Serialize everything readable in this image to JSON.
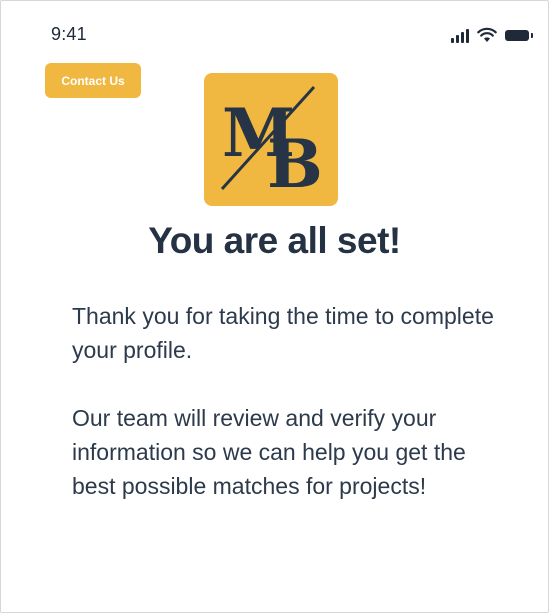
{
  "status_bar": {
    "time": "9:41",
    "icons": [
      "signal-icon",
      "wifi-icon",
      "battery-icon"
    ]
  },
  "header": {
    "contact_label": "Contact Us"
  },
  "logo": {
    "letters": "MB",
    "background_color": "#f0b841",
    "letter_color": "#263445"
  },
  "main": {
    "title": "You are all set!",
    "paragraph_1": "Thank you for taking the time to complete your profile.",
    "paragraph_2": "Our team will review and verify your information so we can help you get the best possible matches for projects!"
  },
  "colors": {
    "accent": "#f0b841",
    "text": "#263445"
  }
}
